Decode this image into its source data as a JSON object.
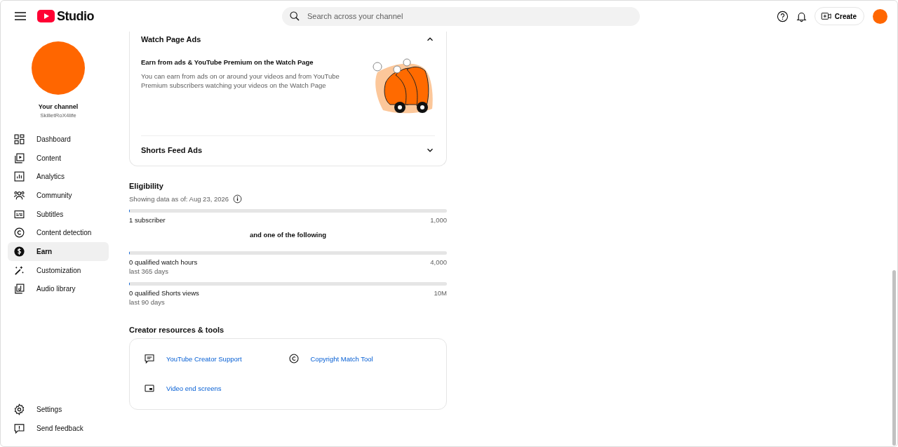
{
  "header": {
    "logo_text": "Studio",
    "search": {
      "placeholder": "Search across your channel"
    },
    "create_label": "Create"
  },
  "channel": {
    "label": "Your channel",
    "name": "SkilletRoX4life"
  },
  "sidebar": {
    "items": [
      {
        "label": "Dashboard",
        "selected": false
      },
      {
        "label": "Content",
        "selected": false
      },
      {
        "label": "Analytics",
        "selected": false
      },
      {
        "label": "Community",
        "selected": false
      },
      {
        "label": "Subtitles",
        "selected": false
      },
      {
        "label": "Content detection",
        "selected": false
      },
      {
        "label": "Earn",
        "selected": true
      },
      {
        "label": "Customization",
        "selected": false
      },
      {
        "label": "Audio library",
        "selected": false
      }
    ],
    "footer_items": [
      {
        "label": "Settings"
      },
      {
        "label": "Send feedback"
      }
    ]
  },
  "ads_card": {
    "sections": [
      {
        "title": "Watch Page Ads",
        "expanded": true,
        "subtitle": "Earn from ads & YouTube Premium on the Watch Page",
        "description": "You can earn from ads on or around your videos and from YouTube Premium subscribers watching your videos on the Watch Page"
      },
      {
        "title": "Shorts Feed Ads",
        "expanded": false
      }
    ]
  },
  "eligibility": {
    "title": "Eligibility",
    "date_note": "Showing data as of: Aug 23, 2026",
    "requirements": [
      {
        "label": "1 subscriber",
        "target": "1,000",
        "level": 0.001
      },
      {
        "kind": "divider",
        "label": "and one of the following"
      },
      {
        "label": "0 qualified watch hours",
        "sub": "last 365 days",
        "target": "4,000",
        "level": 0
      },
      {
        "label": "0 qualified Shorts views",
        "sub": "last 90 days",
        "target": "10M",
        "level": 0
      }
    ]
  },
  "resources": {
    "title": "Creator resources & tools",
    "links": [
      {
        "label": "YouTube Creator Support"
      },
      {
        "label": "Copyright Match Tool"
      },
      {
        "label": "Video end screens"
      }
    ]
  }
}
